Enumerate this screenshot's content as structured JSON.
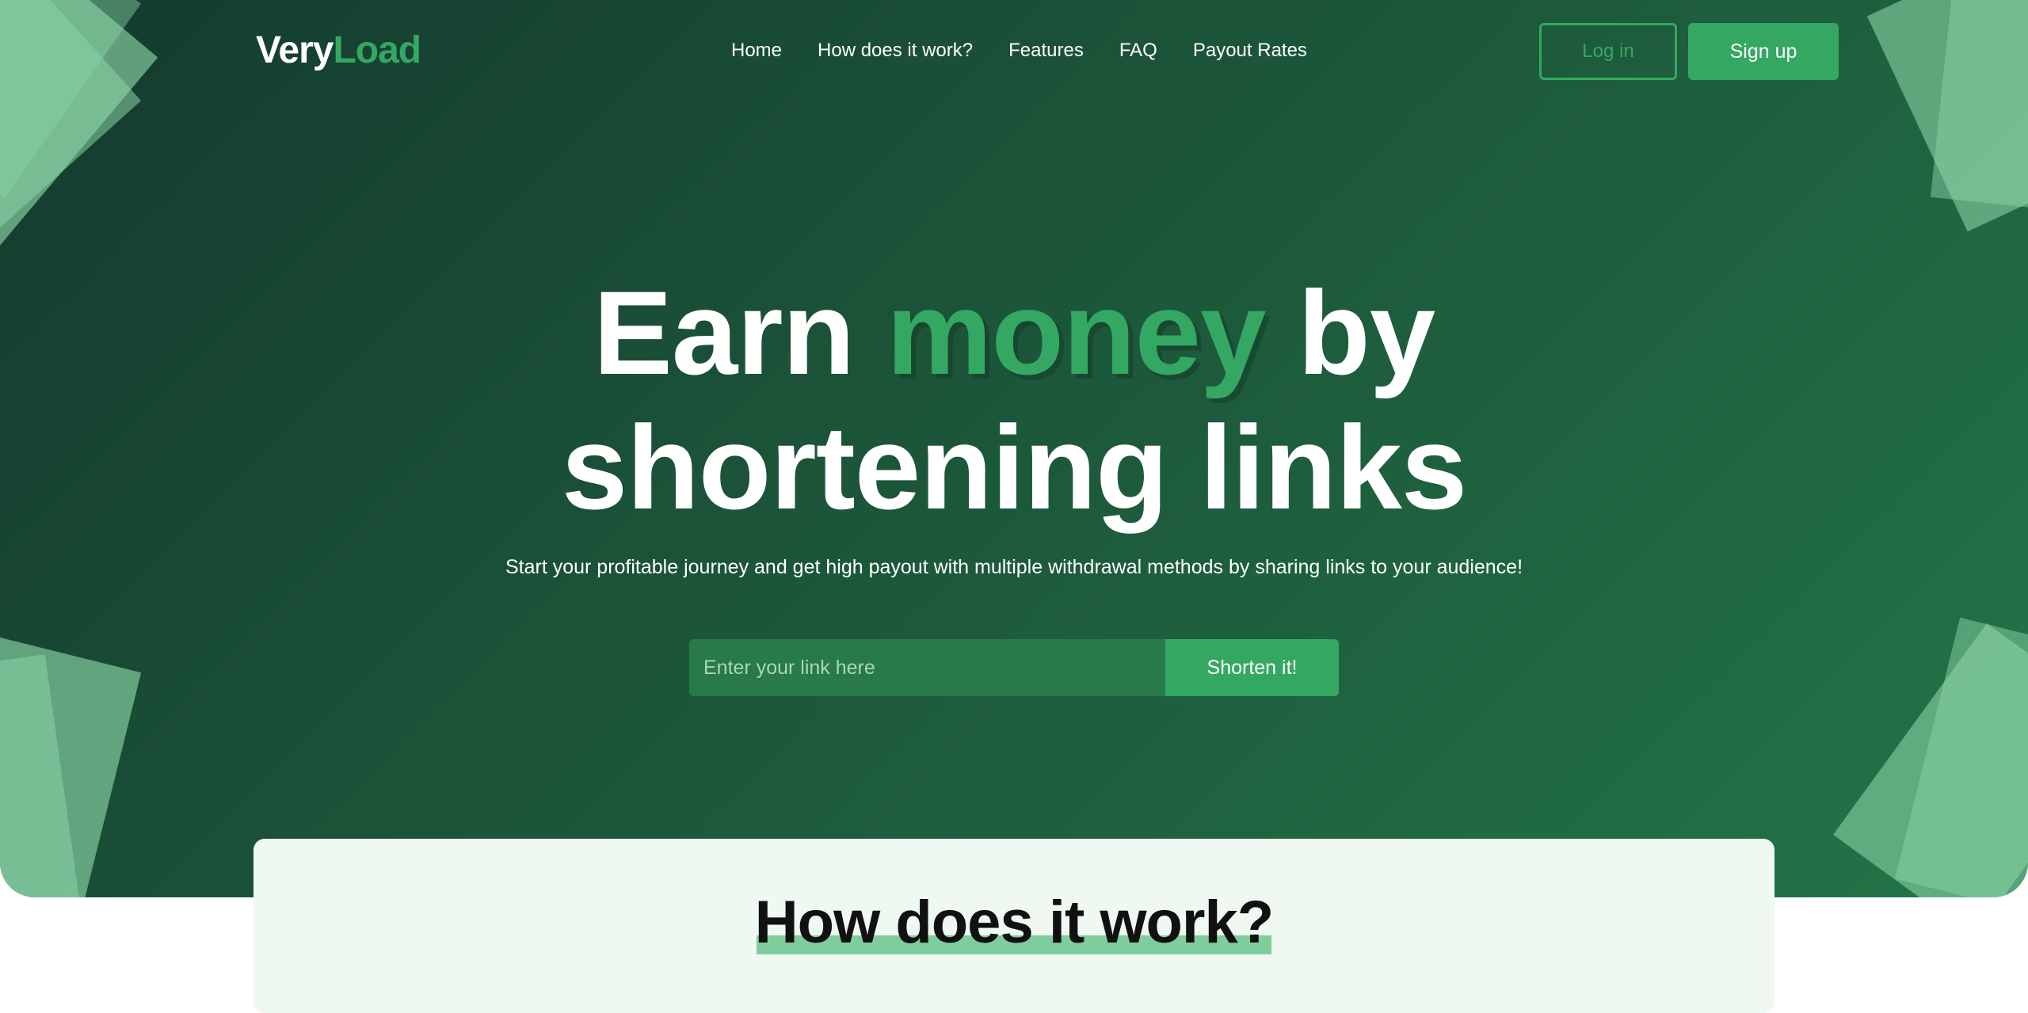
{
  "brand": {
    "name_part1": "Very",
    "name_part2": "Load",
    "accent_color": "#34a862"
  },
  "nav": {
    "items": [
      {
        "label": "Home"
      },
      {
        "label": "How does it work?"
      },
      {
        "label": "Features"
      },
      {
        "label": "FAQ"
      },
      {
        "label": "Payout Rates"
      }
    ]
  },
  "auth": {
    "login_label": "Log in",
    "signup_label": "Sign up"
  },
  "hero": {
    "headline_part1": "Earn",
    "headline_accent": "money",
    "headline_part2": "by",
    "headline_line2": "shortening links",
    "subtitle": "Start your profitable journey and get high payout with multiple withdrawal methods by sharing links to your audience!",
    "input_placeholder": "Enter your link here",
    "input_value": "",
    "button_label": "Shorten it!"
  },
  "how_section": {
    "title": "How does it work?"
  }
}
